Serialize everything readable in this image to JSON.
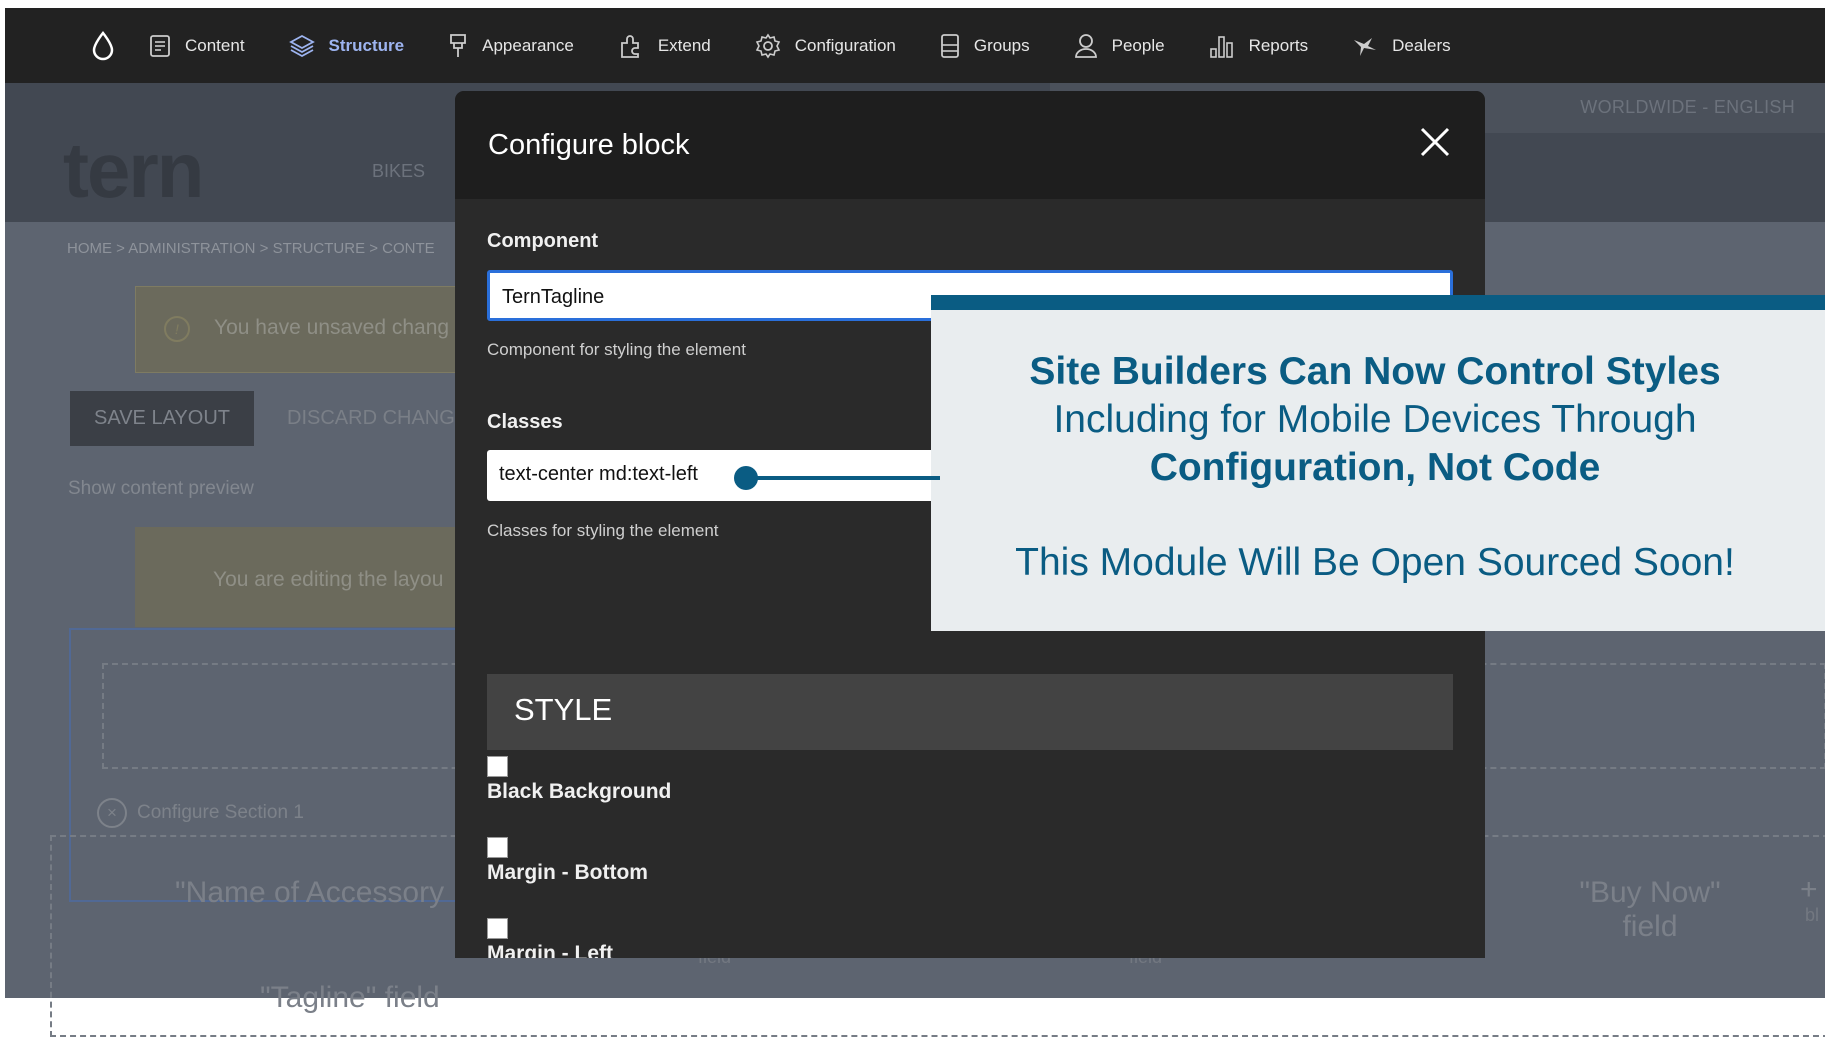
{
  "toolbar": {
    "items": [
      {
        "label": "Content",
        "icon": "content-icon"
      },
      {
        "label": "Structure",
        "icon": "structure-icon",
        "active": true
      },
      {
        "label": "Appearance",
        "icon": "appearance-icon"
      },
      {
        "label": "Extend",
        "icon": "extend-icon"
      },
      {
        "label": "Configuration",
        "icon": "configuration-icon"
      },
      {
        "label": "Groups",
        "icon": "groups-icon"
      },
      {
        "label": "People",
        "icon": "people-icon"
      },
      {
        "label": "Reports",
        "icon": "reports-icon"
      },
      {
        "label": "Dealers",
        "icon": "dealers-icon"
      }
    ],
    "active_color": "#9db4f0"
  },
  "background": {
    "language": "WORLDWIDE - ENGLISH",
    "logo": "tern",
    "nav_item": "BIKES",
    "breadcrumb": "HOME > ADMINISTRATION > STRUCTURE > CONTE",
    "unsaved_message": "You have unsaved chang",
    "save_layout": "SAVE LAYOUT",
    "discard_changes": "DISCARD CHANG",
    "show_preview": "Show content preview",
    "editing_message": "You are editing the layou",
    "configure_section": "Configure Section 1",
    "field_accessory": "\"Name of Accessory",
    "field_buy_now_line1": "\"Buy Now\"",
    "field_buy_now_line2": "field",
    "field_tagline": "\"Tagline\" field",
    "field_small_1": "field",
    "field_small_2": "field",
    "add_block_plus": "+",
    "add_block_text": "bl"
  },
  "modal": {
    "title": "Configure block",
    "component_label": "Component",
    "component_value": "TernTagline",
    "component_help": "Component for styling the element",
    "classes_label": "Classes",
    "classes_value": "text-center md:text-left",
    "classes_help": "Classes for styling the element",
    "style_heading": "STYLE",
    "checkboxes": [
      {
        "label": "Black Background",
        "checked": false
      },
      {
        "label": "Margin - Bottom",
        "checked": false
      },
      {
        "label": "Margin - Left",
        "checked": false
      }
    ]
  },
  "callout": {
    "line1": "Site Builders Can Now Control Styles",
    "line2": "Including for Mobile Devices Through",
    "line3": "Configuration, Not Code",
    "line4": "This Module Will Be Open Sourced Soon!",
    "accent_color": "#0a5c83"
  }
}
